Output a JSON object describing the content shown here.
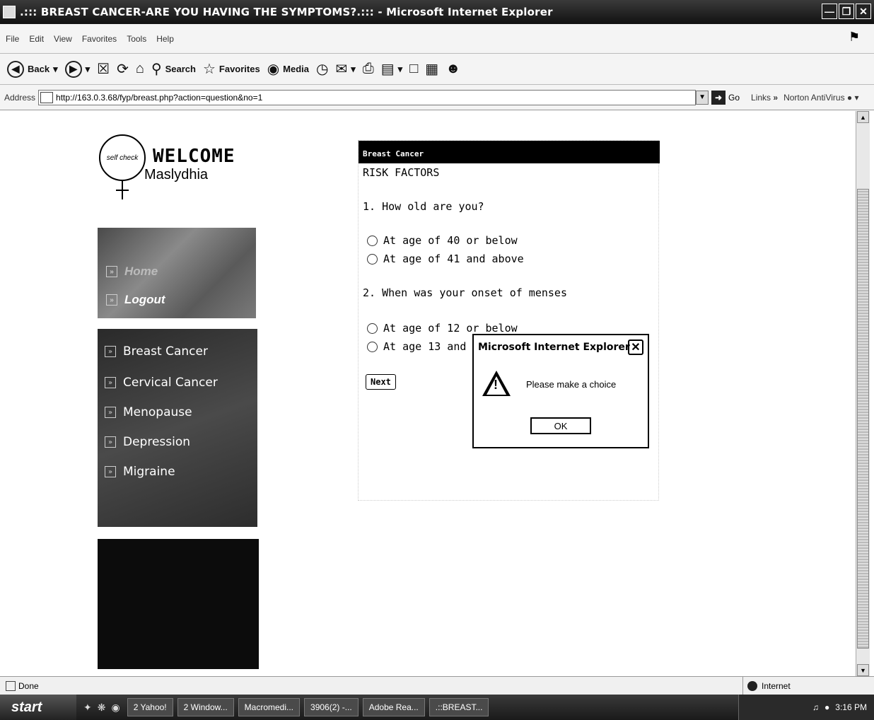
{
  "window": {
    "title": ".::: BREAST CANCER-ARE YOU HAVING THE SYMPTOMS?.::: - Microsoft Internet Explorer"
  },
  "menu": [
    "File",
    "Edit",
    "View",
    "Favorites",
    "Tools",
    "Help"
  ],
  "toolbar": {
    "back": "Back",
    "search": "Search",
    "favorites": "Favorites",
    "media": "Media"
  },
  "address": {
    "label": "Address",
    "url": "http://163.0.3.68/fyp/breast.php?action=question&no=1",
    "go": "Go",
    "links": "Links",
    "links_chevron": "»",
    "norton": "Norton AntiVirus"
  },
  "logo": {
    "ring_text": "self check",
    "welcome": "WELCOME",
    "username": "Maslydhia"
  },
  "nav_top": [
    "Home",
    "Logout"
  ],
  "nav_topics": [
    "Breast Cancer",
    "Cervical Cancer",
    "Menopause",
    "Depression",
    "Migraine"
  ],
  "form": {
    "header": "Breast Cancer",
    "section": "RISK FACTORS",
    "questions": [
      {
        "text": "1. How old are you?",
        "options": [
          "At age of 40 or below",
          "At age of 41 and above"
        ]
      },
      {
        "text": "2. When was your onset of menses",
        "options": [
          "At age of 12 or below",
          "At age 13 and above"
        ]
      }
    ],
    "next": "Next"
  },
  "dialog": {
    "title": "Microsoft Internet Explorer",
    "message": "Please make a choice",
    "ok": "OK"
  },
  "status": {
    "text": "Done",
    "zone": "Internet"
  },
  "taskbar": {
    "start": "start",
    "tasks": [
      "2 Yahoo!",
      "2 Window...",
      "Macromedi...",
      "3906(2) -...",
      "Adobe Rea...",
      ".::BREAST..."
    ],
    "clock": "3:16 PM"
  }
}
